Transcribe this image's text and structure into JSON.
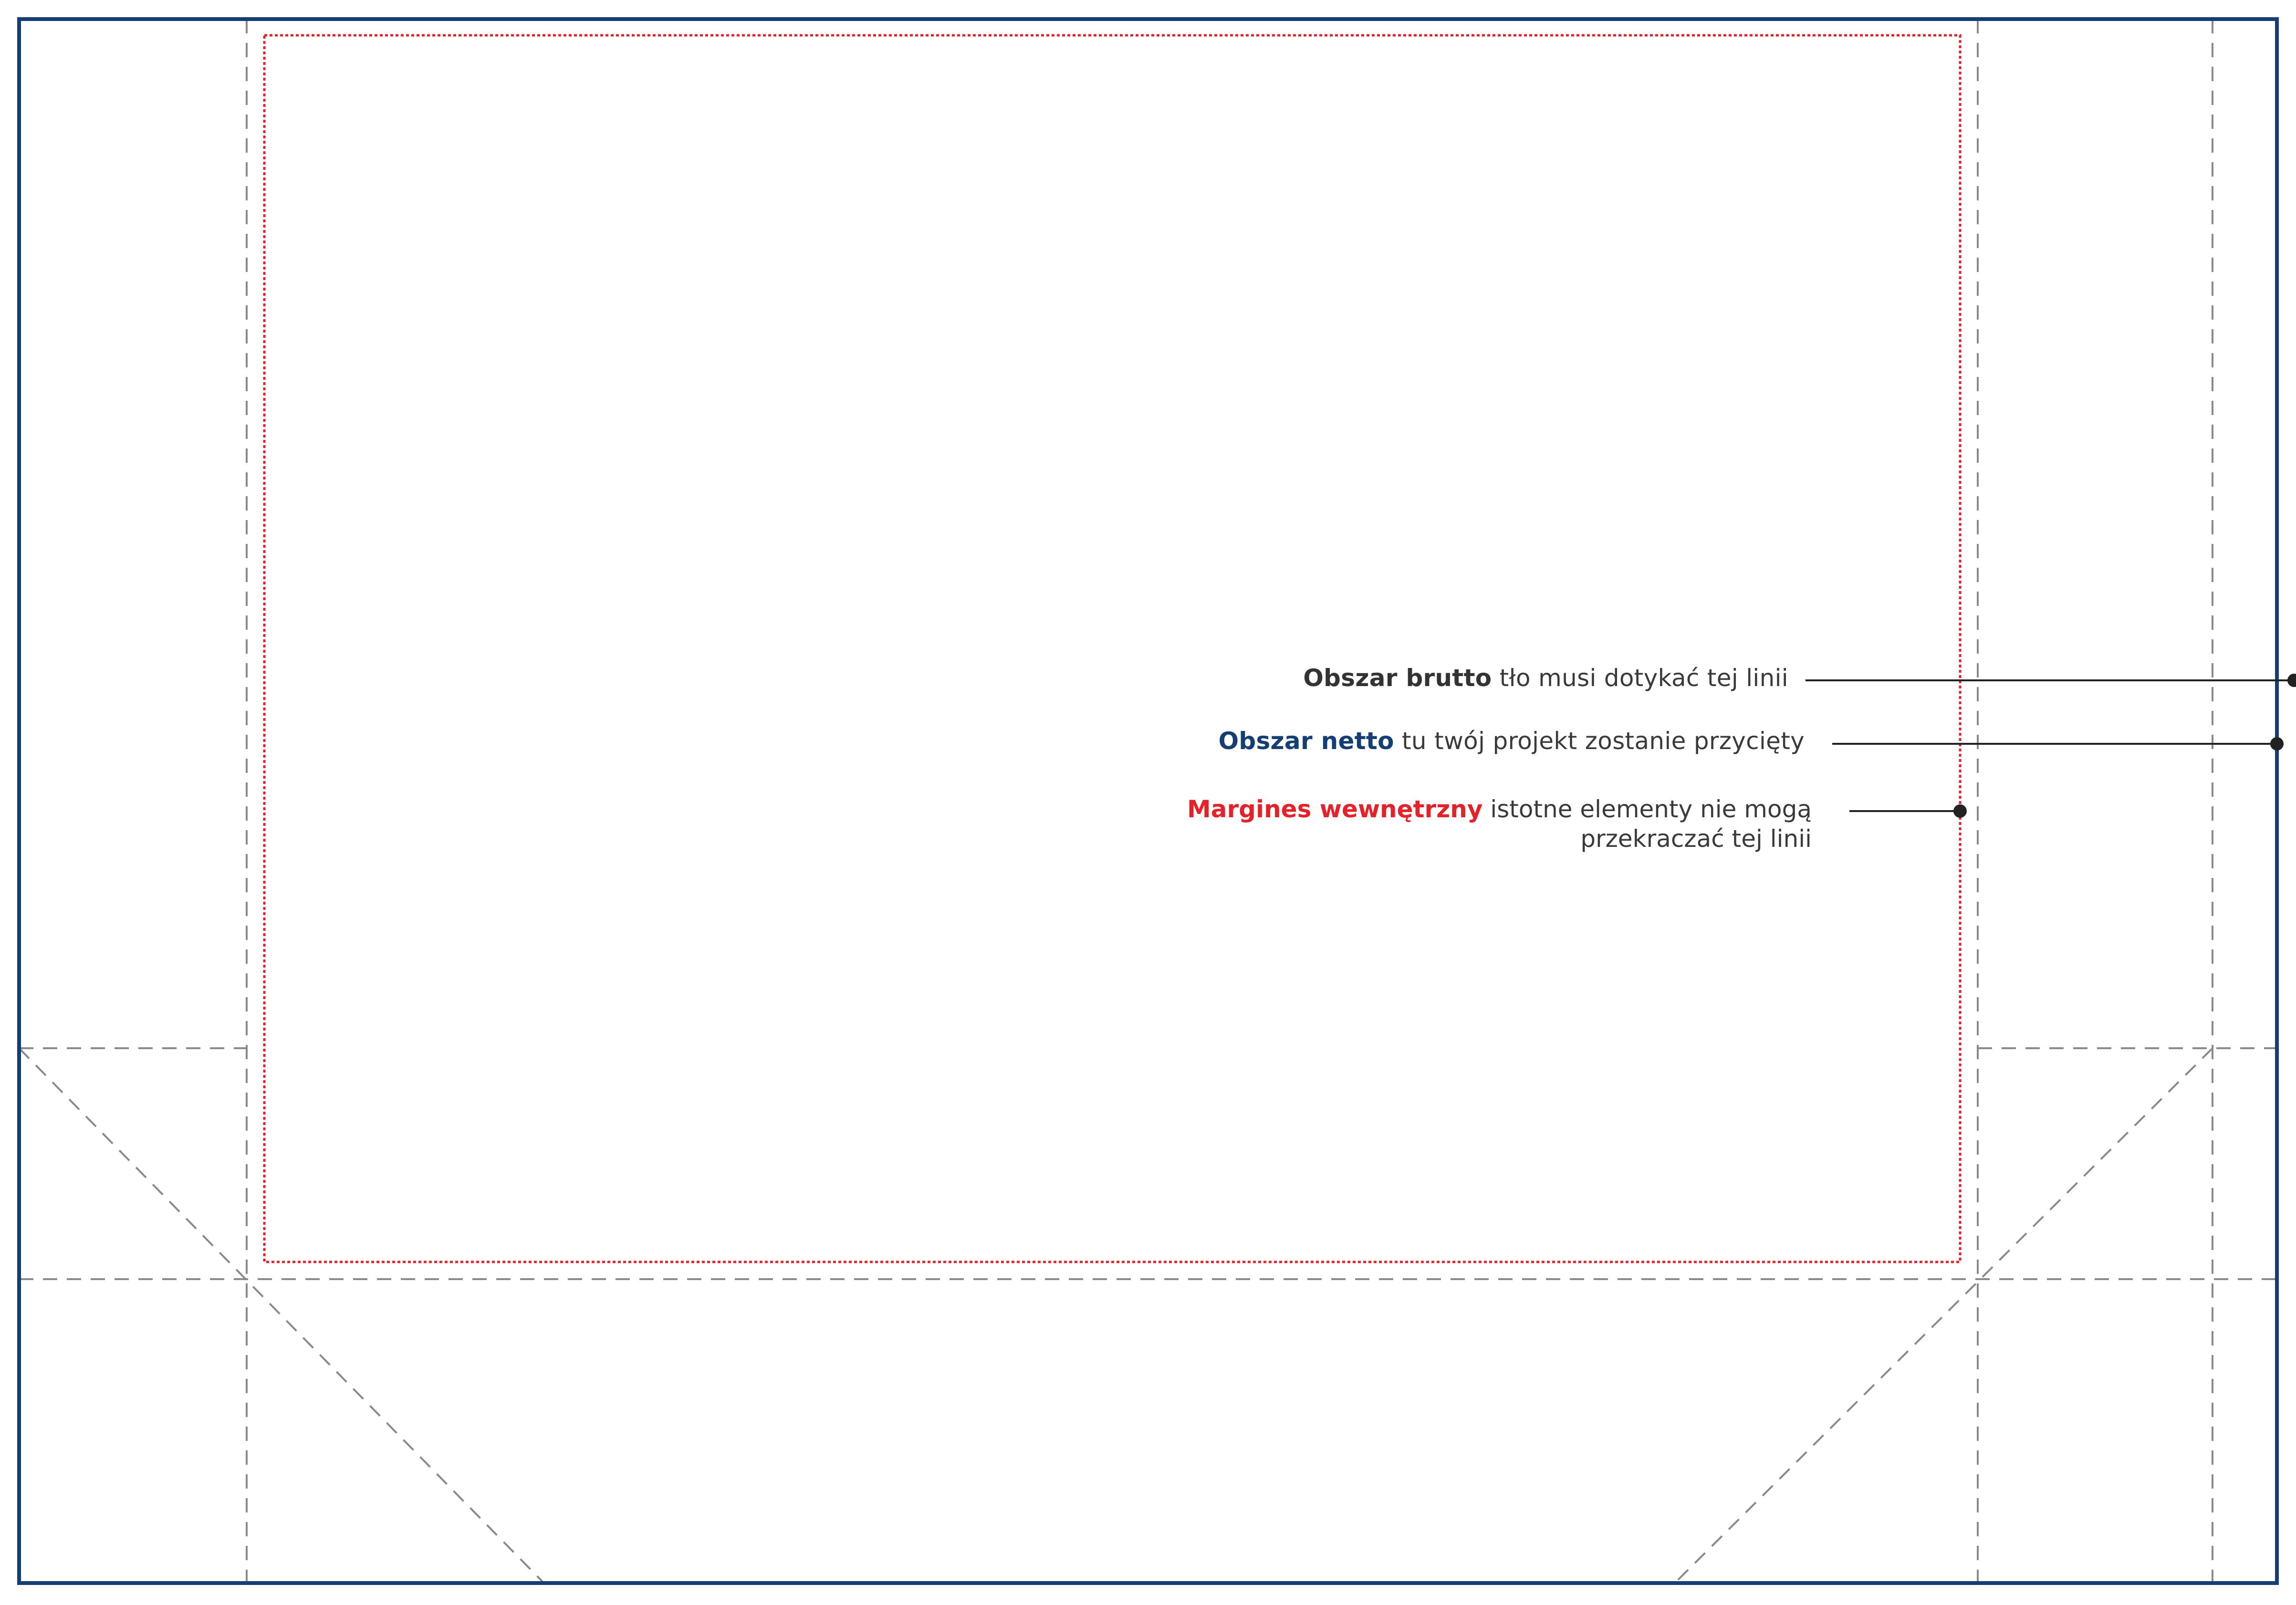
{
  "legend": {
    "brutto": {
      "label": "Obszar brutto",
      "description": "tło musi dotykać tej linii",
      "color": "#333333"
    },
    "netto": {
      "label": "Obszar netto",
      "description": "tu twój projekt zostanie przycięty",
      "color": "#153e73"
    },
    "margines": {
      "label": "Margines wewnętrzny",
      "description_line1": "istotne elementy nie mogą",
      "description_line2": "przekraczać tej linii",
      "color": "#e3222a"
    }
  },
  "colors": {
    "trim_border": "#153e73",
    "safe_margin": "#e3222a",
    "fold_lines": "#8a8a8a",
    "leader_lines": "#222222",
    "outer_frame": "#5a5a5a",
    "paper": "#ffffff"
  }
}
